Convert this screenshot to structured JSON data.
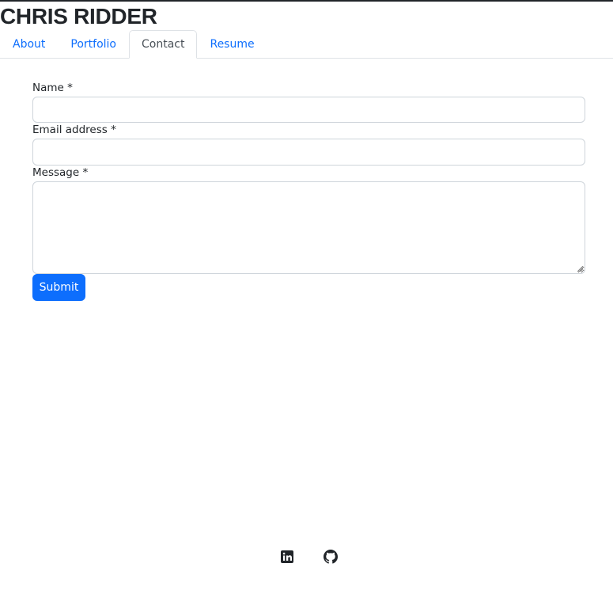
{
  "header": {
    "title": "CHRIS RIDDER"
  },
  "nav": {
    "tabs": [
      {
        "label": "About",
        "active": false
      },
      {
        "label": "Portfolio",
        "active": false
      },
      {
        "label": "Contact",
        "active": true
      },
      {
        "label": "Resume",
        "active": false
      }
    ]
  },
  "form": {
    "name_label": "Name *",
    "name_value": "",
    "email_label": "Email address *",
    "email_value": "",
    "message_label": "Message *",
    "message_value": "",
    "submit_label": "Submit"
  },
  "footer": {
    "icons": [
      "linkedin-icon",
      "github-icon"
    ]
  },
  "colors": {
    "accent": "#0d6efd",
    "text": "#212529",
    "border": "#ced4da"
  }
}
